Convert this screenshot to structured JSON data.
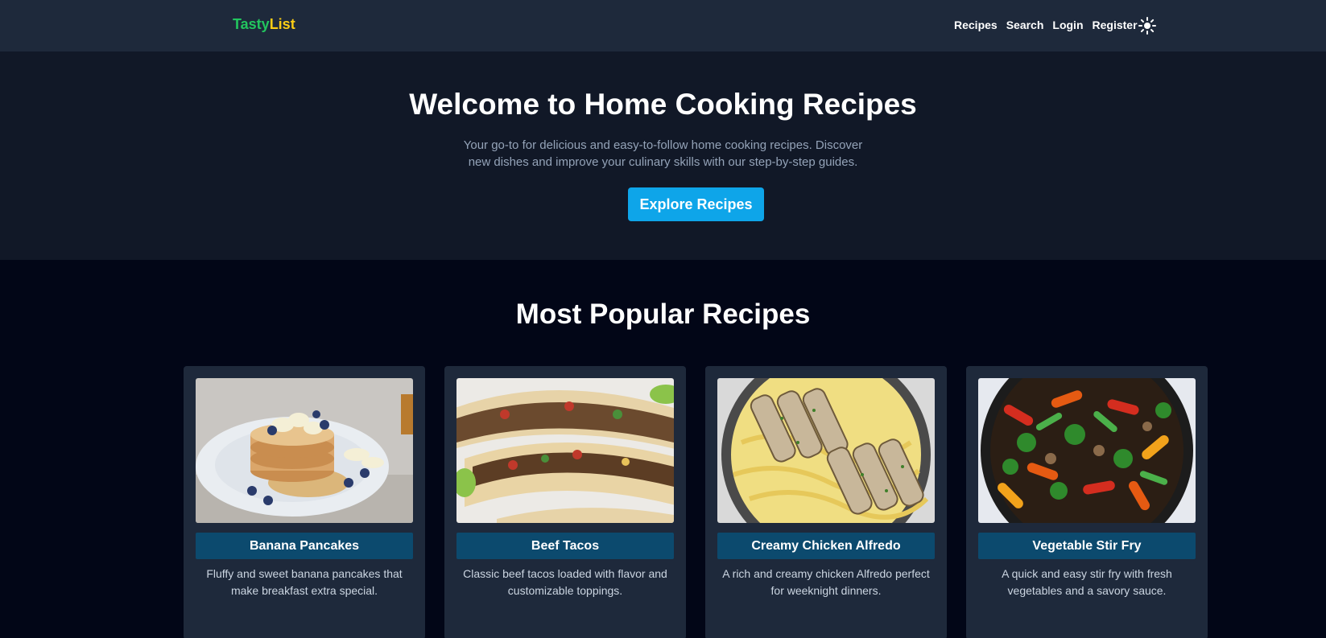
{
  "nav": {
    "logo_part1": "Tasty",
    "logo_part2": "List",
    "links": [
      "Recipes",
      "Search",
      "Login",
      "Register"
    ],
    "theme_icon": "sun-icon"
  },
  "hero": {
    "title": "Welcome to Home Cooking Recipes",
    "subtitle": "Your go-to for delicious and easy-to-follow home cooking recipes. Discover new dishes and improve your culinary skills with our step-by-step guides.",
    "button": "Explore Recipes"
  },
  "popular": {
    "title": "Most Popular Recipes",
    "cards": [
      {
        "title": "Banana Pancakes",
        "description": "Fluffy and sweet banana pancakes that make breakfast extra special."
      },
      {
        "title": "Beef Tacos",
        "description": "Classic beef tacos loaded with flavor and customizable toppings."
      },
      {
        "title": "Creamy Chicken Alfredo",
        "description": "A rich and creamy chicken Alfredo perfect for weeknight dinners."
      },
      {
        "title": "Vegetable Stir Fry",
        "description": "A quick and easy stir fry with fresh vegetables and a savory sauce."
      }
    ]
  },
  "colors": {
    "navbar": "#1e293b",
    "hero_bg": "#111827",
    "page_bg": "#020617",
    "accent_button": "#0ea5e9",
    "card_title_bg": "#0c4a6e",
    "logo_green": "#22c55e",
    "logo_yellow": "#facc15"
  }
}
